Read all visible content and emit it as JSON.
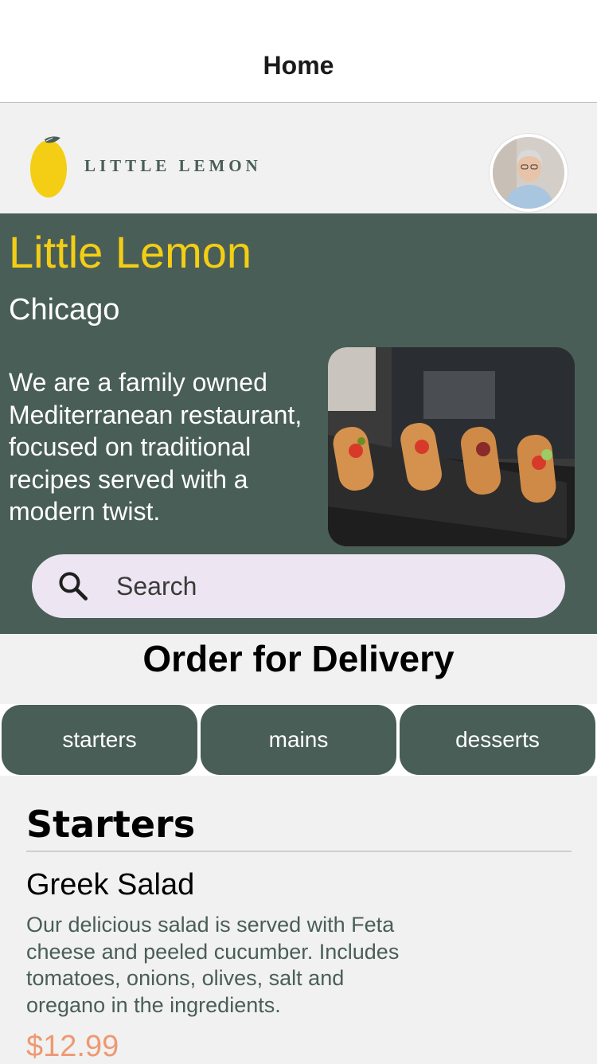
{
  "nav": {
    "title": "Home"
  },
  "header": {
    "logo_text": "LITTLE LEMON",
    "logo_icon": "lemon-icon",
    "avatar_icon": "profile-avatar"
  },
  "hero": {
    "title": "Little Lemon",
    "city": "Chicago",
    "description": "We are a family owned Mediterranean restaurant, focused on traditional recipes served with a modern twist.",
    "image_icon": "food-platter-image"
  },
  "search": {
    "placeholder": "Search",
    "icon": "search-icon"
  },
  "order": {
    "title": "Order for Delivery",
    "tabs": [
      {
        "label": "starters"
      },
      {
        "label": "mains"
      },
      {
        "label": "desserts"
      }
    ]
  },
  "menu": {
    "section_title": "Starters",
    "items": [
      {
        "name": "Greek Salad",
        "description": "Our delicious salad is served with Feta cheese and peeled cucumber. Includes tomatoes, onions, olives, salt and oregano in the ingredients.",
        "price": "$12.99"
      }
    ]
  },
  "colors": {
    "primary_green": "#495e57",
    "primary_yellow": "#f4ce14",
    "price_orange": "#ee9972",
    "search_bg": "#ede6f2"
  }
}
